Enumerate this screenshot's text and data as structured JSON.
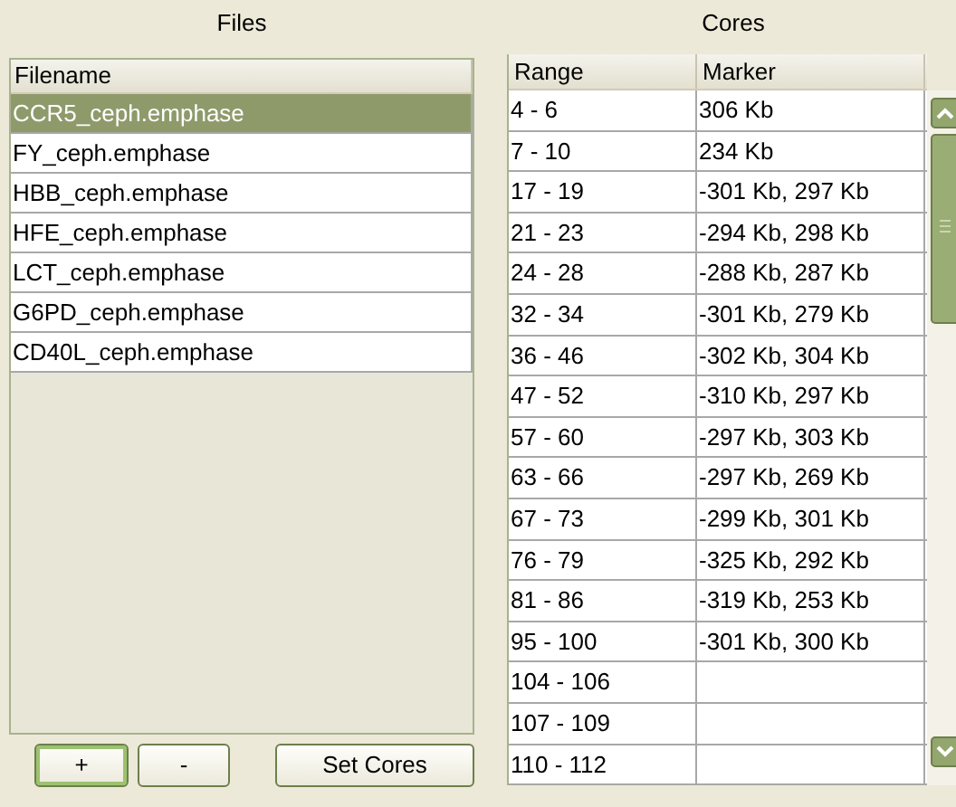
{
  "files": {
    "title": "Files",
    "column": "Filename",
    "items": [
      {
        "name": "CCR5_ceph.emphase",
        "selected": true
      },
      {
        "name": "FY_ceph.emphase",
        "selected": false
      },
      {
        "name": "HBB_ceph.emphase",
        "selected": false
      },
      {
        "name": "HFE_ceph.emphase",
        "selected": false
      },
      {
        "name": "LCT_ceph.emphase",
        "selected": false
      },
      {
        "name": "G6PD_ceph.emphase",
        "selected": false
      },
      {
        "name": "CD40L_ceph.emphase",
        "selected": false
      }
    ],
    "buttons": [
      {
        "label": "+",
        "focused": true
      },
      {
        "label": "-",
        "focused": false
      },
      {
        "label": "Set Cores",
        "focused": false
      }
    ]
  },
  "cores": {
    "title": "Cores",
    "columns": [
      "Range",
      "Marker"
    ],
    "rows": [
      [
        "4 - 6",
        "306 Kb"
      ],
      [
        "7 - 10",
        "234 Kb"
      ],
      [
        "17 - 19",
        "-301 Kb, 297 Kb"
      ],
      [
        "21 - 23",
        "-294 Kb, 298 Kb"
      ],
      [
        "24 - 28",
        "-288 Kb, 287 Kb"
      ],
      [
        "32 - 34",
        "-301 Kb, 279 Kb"
      ],
      [
        "36 - 46",
        "-302 Kb, 304 Kb"
      ],
      [
        "47 - 52",
        "-310 Kb, 297 Kb"
      ],
      [
        "57 - 60",
        "-297 Kb, 303 Kb"
      ],
      [
        "63 - 66",
        "-297 Kb, 269 Kb"
      ],
      [
        "67 - 73",
        "-299 Kb, 301 Kb"
      ],
      [
        "76 - 79",
        "-325 Kb, 292 Kb"
      ],
      [
        "81 - 86",
        "-319 Kb, 253 Kb"
      ],
      [
        "95 - 100",
        "-301 Kb, 300 Kb"
      ],
      [
        "104 - 106",
        ""
      ],
      [
        "107 - 109",
        ""
      ],
      [
        "110 - 112",
        ""
      ]
    ]
  }
}
